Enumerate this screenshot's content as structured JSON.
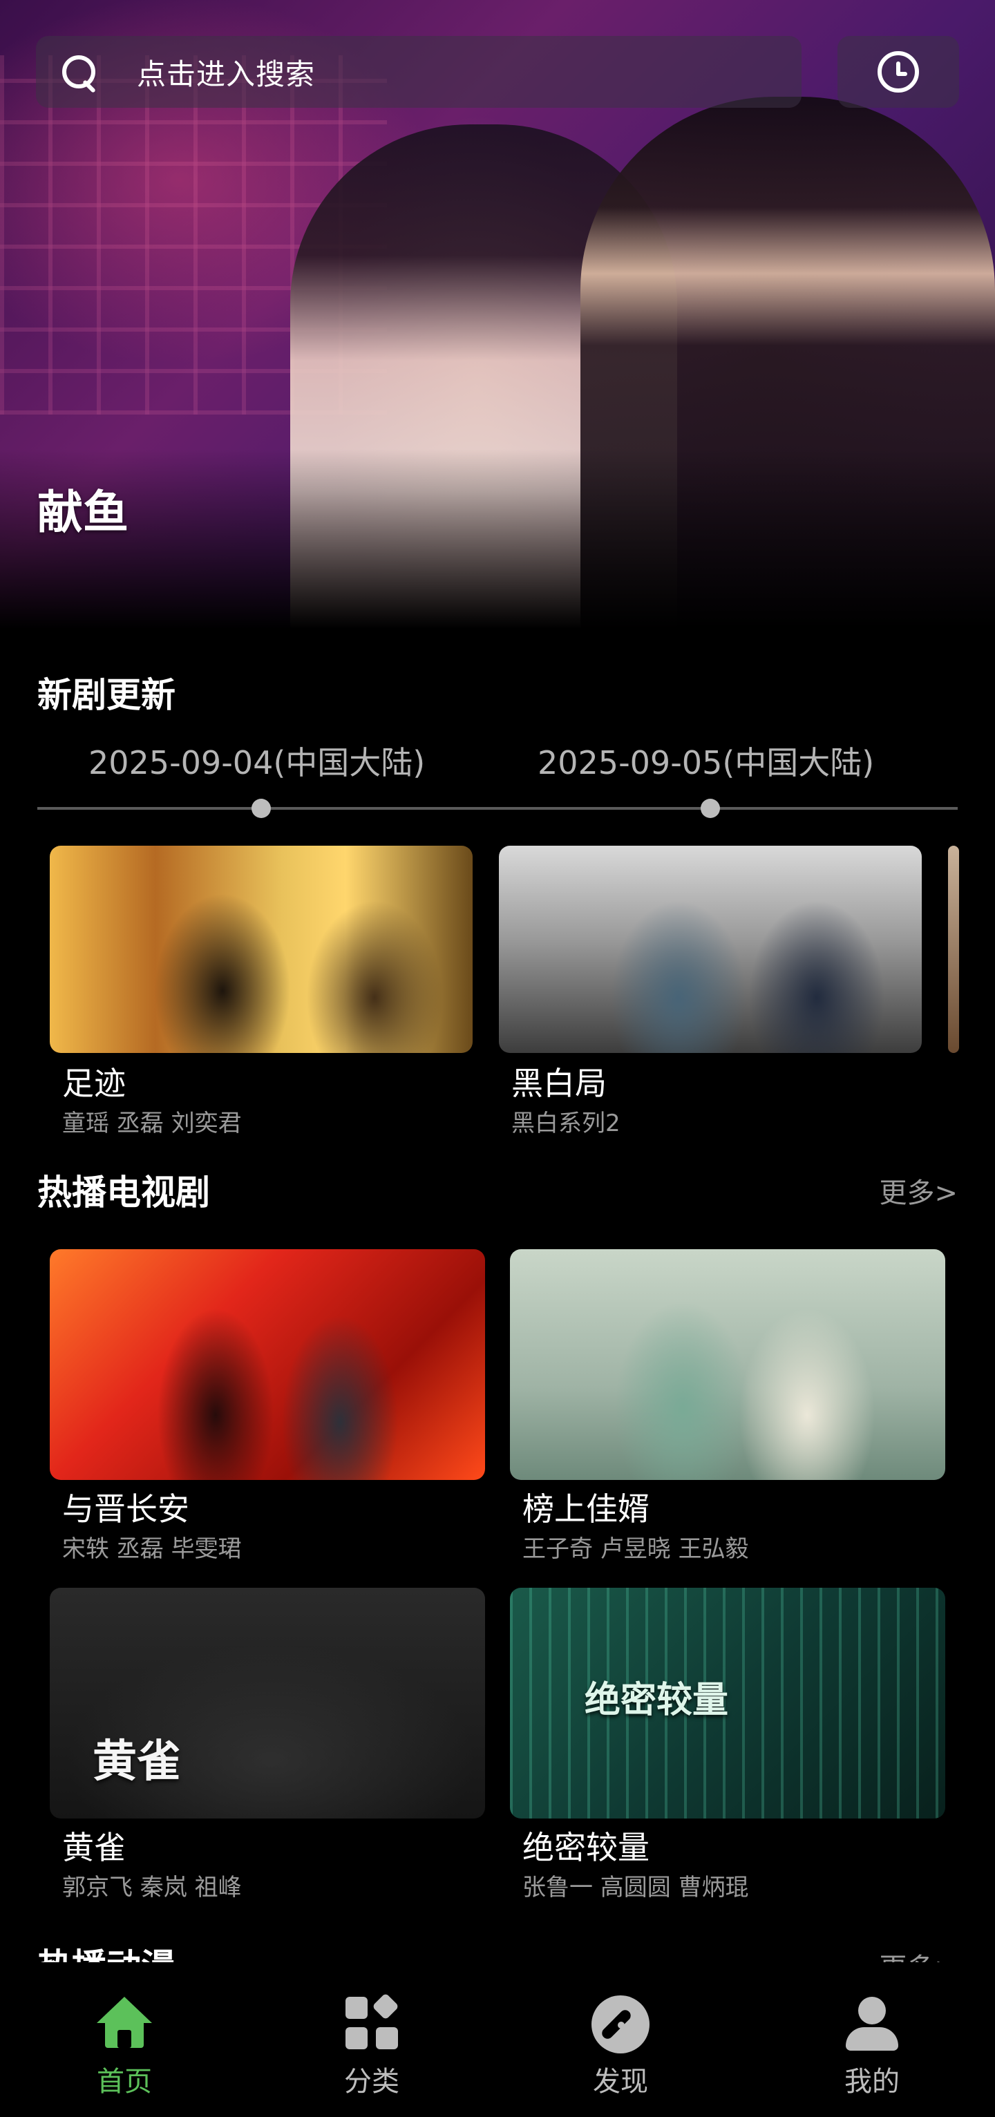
{
  "search": {
    "placeholder": "点击进入搜索"
  },
  "hero": {
    "title": "献鱼"
  },
  "new_updates": {
    "title": "新剧更新",
    "dates": [
      "2025-09-04(中国大陆)",
      "2025-09-05(中国大陆)"
    ],
    "cards": [
      {
        "title": "足迹",
        "subtitle": "童瑶 丞磊 刘奕君"
      },
      {
        "title": "黑白局",
        "subtitle": "黑白系列2"
      }
    ]
  },
  "hot_tv": {
    "title": "热播电视剧",
    "more": "更多>",
    "cards": [
      {
        "title": "与晋长安",
        "subtitle": "宋轶 丞磊 毕雯珺"
      },
      {
        "title": "榜上佳婿",
        "subtitle": "王子奇 卢昱晓 王弘毅"
      },
      {
        "title": "黄雀",
        "subtitle": "郭京飞 秦岚 祖峰",
        "poster_text": "黄雀"
      },
      {
        "title": "绝密较量",
        "subtitle": "张鲁一 高圆圆 曹炳琨",
        "poster_text": "绝密较量"
      }
    ]
  },
  "hot_anime": {
    "title": "热播动漫",
    "more": "更多>"
  },
  "bottom_nav": {
    "items": [
      {
        "label": "首页",
        "icon": "home-icon",
        "active": true
      },
      {
        "label": "分类",
        "icon": "category-icon",
        "active": false
      },
      {
        "label": "发现",
        "icon": "compass-icon",
        "active": false
      },
      {
        "label": "我的",
        "icon": "user-icon",
        "active": false
      }
    ],
    "active_color": "#5cc15a",
    "inactive_color": "#bdbdbd"
  }
}
